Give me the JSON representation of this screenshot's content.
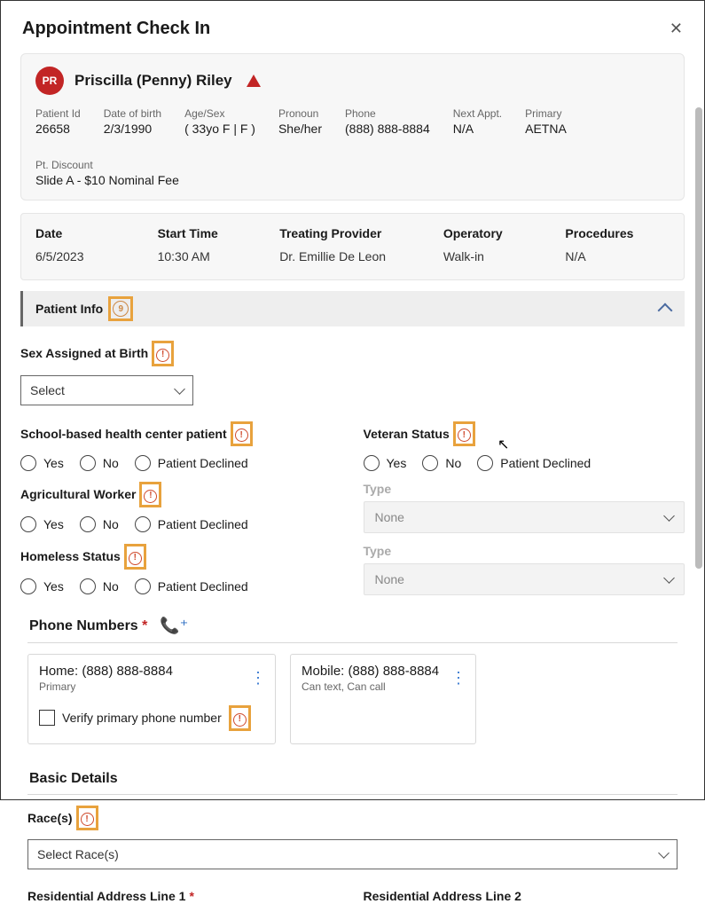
{
  "header": {
    "title": "Appointment Check In"
  },
  "patient": {
    "initials": "PR",
    "name": "Priscilla (Penny) Riley",
    "fields": {
      "id_label": "Patient Id",
      "id": "26658",
      "dob_label": "Date of birth",
      "dob": "2/3/1990",
      "agesex_label": "Age/Sex",
      "agesex": "( 33yo F | F )",
      "pronoun_label": "Pronoun",
      "pronoun": "She/her",
      "phone_label": "Phone",
      "phone": "(888) 888-8884",
      "next_label": "Next Appt.",
      "next": "N/A",
      "primary_label": "Primary",
      "primary": "AETNA",
      "disc_label": "Pt. Discount",
      "disc": "Slide A - $10 Nominal Fee"
    }
  },
  "appointment": {
    "date_label": "Date",
    "date": "6/5/2023",
    "start_label": "Start Time",
    "start": "10:30 AM",
    "prov_label": "Treating Provider",
    "prov": "Dr. Emillie De Leon",
    "op_label": "Operatory",
    "op": "Walk-in",
    "proc_label": "Procedures",
    "proc": "N/A"
  },
  "accordion": {
    "title": "Patient Info",
    "count": "9"
  },
  "form": {
    "sab_label": "Sex Assigned at Birth",
    "sab_placeholder": "Select",
    "schp_label": "School-based health center patient",
    "vet_label": "Veteran Status",
    "ag_label": "Agricultural Worker",
    "hs_label": "Homeless Status",
    "type_label": "Type",
    "type_value": "None",
    "yes": "Yes",
    "no": "No",
    "pd": "Patient Declined"
  },
  "phones": {
    "section": "Phone Numbers",
    "home_label": "Home: (888) 888-8884",
    "home_sub": "Primary",
    "verify": "Verify primary phone number",
    "mobile_label": "Mobile: (888) 888-8884",
    "mobile_sub": "Can text, Can call"
  },
  "basic": {
    "section": "Basic Details",
    "race_label": "Race(s)",
    "race_placeholder": "Select Race(s)",
    "addr1_label": "Residential Address Line 1",
    "addr2_label": "Residential Address Line 2"
  }
}
